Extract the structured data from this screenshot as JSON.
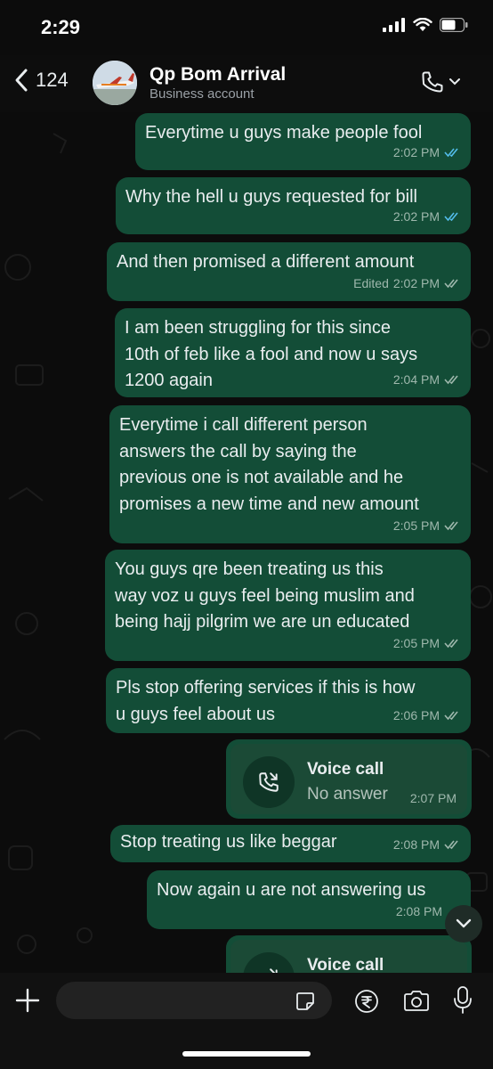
{
  "status_bar": {
    "time": "2:29"
  },
  "header": {
    "back_count": "124",
    "title": "Qp Bom Arrival",
    "subtitle": "Business account"
  },
  "messages": [
    {
      "text": "Everytime u guys make people fool",
      "time": "2:02 PM",
      "ticks": "read"
    },
    {
      "text": "Why the hell u guys requested for bill",
      "time": "2:02 PM",
      "ticks": "read"
    },
    {
      "text": "And then promised a different amount",
      "edited": "Edited",
      "time": "2:02 PM",
      "ticks": "delivered"
    },
    {
      "text": "I am been struggling for this since\n10th of feb like a fool and now u says\n1200 again",
      "time": "2:04 PM",
      "ticks": "delivered"
    },
    {
      "text": "Everytime i call different person\nanswers the call by saying the\nprevious one is not available and he\npromises a new time and new amount",
      "time": "2:05 PM",
      "ticks": "delivered"
    },
    {
      "text": "You guys qre been treating us this\nway voz u guys feel being muslim and\nbeing hajj pilgrim we are un educated",
      "time": "2:05 PM",
      "ticks": "delivered"
    },
    {
      "text": "Pls stop offering services if this is how\nu guys feel about us",
      "time": "2:06 PM",
      "ticks": "delivered"
    },
    {
      "text": "Stop treating us like beggar",
      "time": "2:08 PM",
      "ticks": "delivered"
    },
    {
      "text": "Now again u are not answering us",
      "time": "2:08 PM",
      "ticks": "delivered"
    }
  ],
  "calls": [
    {
      "title": "Voice call",
      "status": "No answer",
      "time": "2:07 PM",
      "icon": "missed-call-icon"
    },
    {
      "title": "Voice call",
      "icon": "missed-call-icon"
    }
  ],
  "input": {
    "placeholder": ""
  },
  "colors": {
    "bubble": "#134d37",
    "read_ticks": "#53bdeb",
    "delivered_ticks": "#9fb8ad"
  }
}
